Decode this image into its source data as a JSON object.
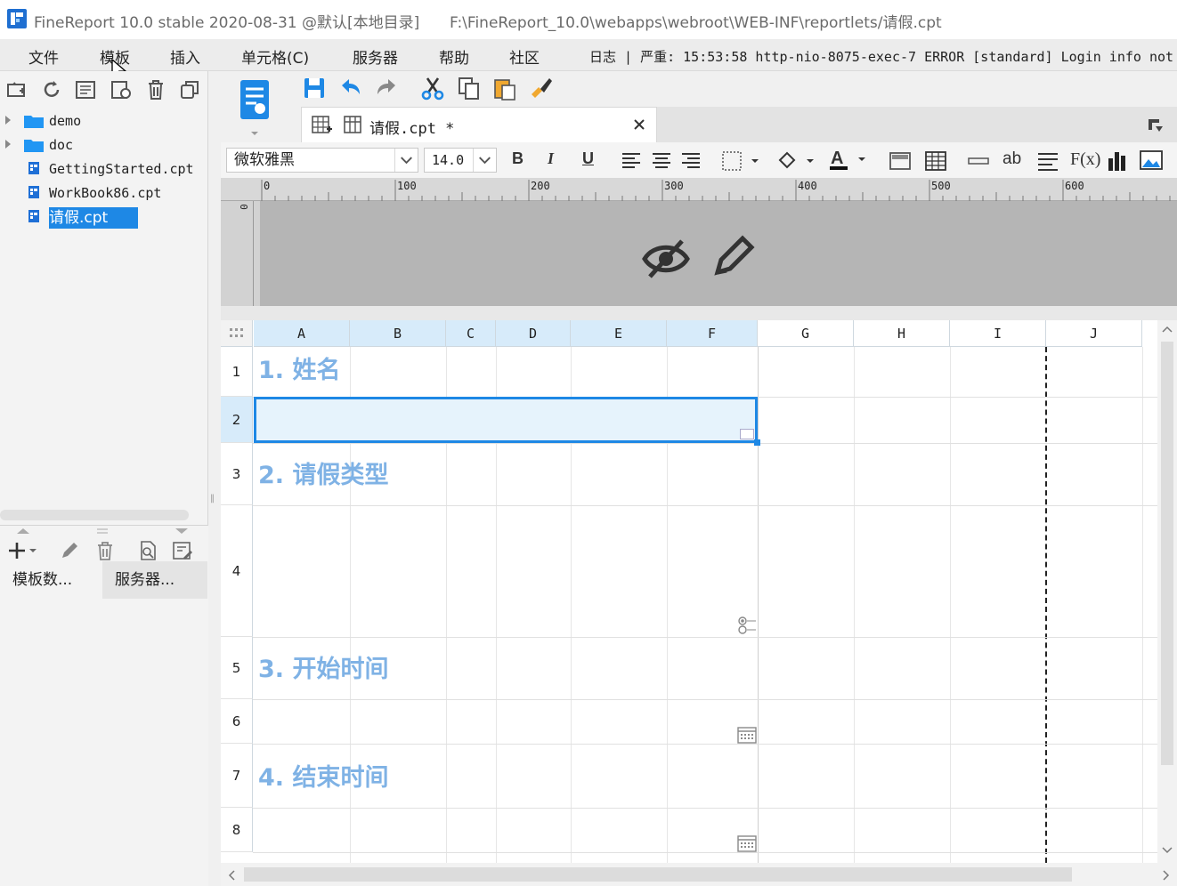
{
  "window": {
    "title": "FineReport 10.0 stable 2020-08-31 @默认[本地目录]",
    "path": "F:\\FineReport_10.0\\webapps\\webroot\\WEB-INF\\reportlets/请假.cpt"
  },
  "menu": {
    "items": [
      "文件",
      "模板",
      "插入",
      "单元格(C)",
      "服务器",
      "帮助",
      "社区"
    ],
    "log": "日志 | 严重: 15:53:58 http-nio-8075-exec-7 ERROR [standard] Login info not"
  },
  "tree": {
    "items": [
      {
        "label": "demo",
        "type": "folder"
      },
      {
        "label": "doc",
        "type": "folder"
      },
      {
        "label": "GettingStarted.cpt",
        "type": "file"
      },
      {
        "label": "WorkBook86.cpt",
        "type": "file"
      },
      {
        "label": "请假.cpt",
        "type": "file",
        "selected": true
      }
    ]
  },
  "bottom_tabs": {
    "tab1": "模板数...",
    "tab2": "服务器..."
  },
  "editor_tab": {
    "label": "请假.cpt *"
  },
  "format": {
    "font": "微软雅黑",
    "size": "14.0"
  },
  "ruler": {
    "ticks": [
      "0",
      "100",
      "200",
      "300",
      "400",
      "500",
      "600"
    ],
    "vtick": "0"
  },
  "grid": {
    "columns": [
      "A",
      "B",
      "C",
      "D",
      "E",
      "F",
      "G",
      "H",
      "I",
      "J"
    ],
    "rows": [
      "1",
      "2",
      "3",
      "4",
      "5",
      "6",
      "7",
      "8"
    ],
    "cells": {
      "r1": "1. 姓名",
      "r3": "2. 请假类型",
      "r5": "3. 开始时间",
      "r7": "4. 结束时间"
    }
  },
  "colors": {
    "accent": "#1e88e5",
    "title_text": "#7fb2e5",
    "header_sel": "#d7ebfa"
  }
}
